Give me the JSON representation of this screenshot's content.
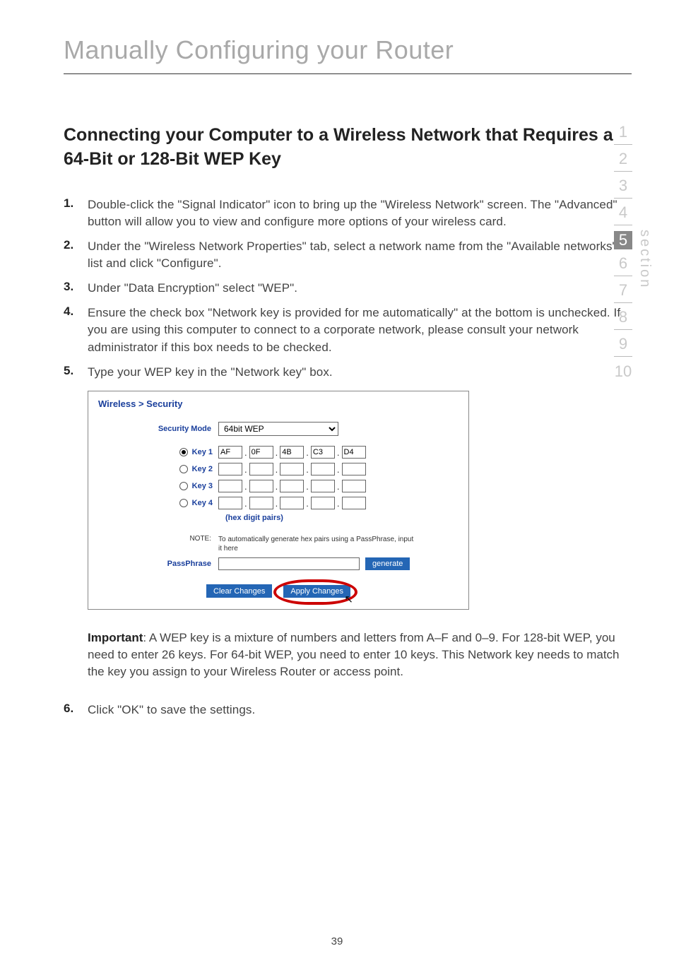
{
  "chapterTitle": "Manually Configuring your Router",
  "sectionHeading": "Connecting your Computer to a Wireless Network that Requires a 64-Bit or 128-Bit WEP Key",
  "steps": [
    {
      "num": "1.",
      "text": "Double-click the \"Signal Indicator\" icon to bring up the \"Wireless Network\" screen. The \"Advanced\" button will allow you to view and configure more options of your wireless card."
    },
    {
      "num": "2.",
      "text": "Under the \"Wireless Network Properties\" tab, select a network name from the \"Available networks\" list and click \"Configure\"."
    },
    {
      "num": "3.",
      "text": "Under \"Data Encryption\" select \"WEP\"."
    },
    {
      "num": "4.",
      "text": "Ensure the check box \"Network key is provided for me automatically\" at the bottom is unchecked. If you are using this computer to connect to a corporate network, please consult your network administrator if this box needs to be checked."
    },
    {
      "num": "5.",
      "text": "Type your WEP key in the \"Network key\" box."
    }
  ],
  "shot": {
    "breadcrumb": "Wireless > Security",
    "securityModeLabel": "Security Mode",
    "securityModeValue": "64bit WEP",
    "keys": [
      {
        "label": "Key 1",
        "selected": true,
        "vals": [
          "AF",
          "0F",
          "4B",
          "C3",
          "D4"
        ]
      },
      {
        "label": "Key 2",
        "selected": false,
        "vals": [
          "",
          "",
          "",
          "",
          ""
        ]
      },
      {
        "label": "Key 3",
        "selected": false,
        "vals": [
          "",
          "",
          "",
          "",
          ""
        ]
      },
      {
        "label": "Key 4",
        "selected": false,
        "vals": [
          "",
          "",
          "",
          "",
          ""
        ]
      }
    ],
    "hexCaption": "(hex digit pairs)",
    "noteLabel": "NOTE:",
    "noteText": "To automatically generate hex pairs using a PassPhrase, input it here",
    "passphraseLabel": "PassPhrase",
    "generateBtn": "generate",
    "clearBtn": "Clear Changes",
    "applyBtn": "Apply Changes"
  },
  "importantLabel": "Important",
  "importantText": ": A WEP key is a mixture of numbers and letters from A–F and 0–9. For 128-bit WEP, you need to enter 26 keys. For 64-bit WEP, you need to enter 10 keys. This Network key needs to match the key you assign to your Wireless Router or access point.",
  "step6": {
    "num": "6.",
    "text": "Click \"OK\" to save the settings."
  },
  "sideNav": {
    "label": "section",
    "items": [
      "1",
      "2",
      "3",
      "4",
      "5",
      "6",
      "7",
      "8",
      "9",
      "10"
    ],
    "activeIndex": 4
  },
  "pageNumber": "39"
}
